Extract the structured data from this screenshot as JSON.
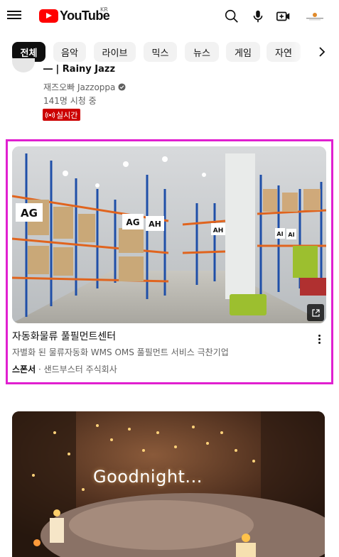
{
  "header": {
    "logo_text": "YouTube",
    "region": "KR"
  },
  "chips": [
    {
      "label": "전체",
      "active": true
    },
    {
      "label": "음악",
      "active": false
    },
    {
      "label": "라이브",
      "active": false
    },
    {
      "label": "믹스",
      "active": false
    },
    {
      "label": "뉴스",
      "active": false
    },
    {
      "label": "게임",
      "active": false
    },
    {
      "label": "자연",
      "active": false
    }
  ],
  "live_video": {
    "title": "― | Rainy Jazz",
    "channel": "재즈오빠 Jazzoppa",
    "views": "141명 시청 중",
    "badge": "실시간"
  },
  "ad": {
    "title": "자동화물류 풀필먼트센터",
    "description": "자별화 된 물류자동화 WMS OMS 풀필먼트 서비스 극찬기업",
    "sponsor_label": "스폰서",
    "separator": " · ",
    "advertiser": "샌드부스터 주식회사",
    "thumbnail_signs": [
      "AG",
      "AG",
      "AH",
      "AH",
      "AI",
      "AI"
    ]
  },
  "next_video": {
    "thumbnail_text": "Goodnight..."
  },
  "colors": {
    "brand_red": "#ff0000",
    "live_red": "#cc0000",
    "highlight_border": "#e020d0",
    "chip_bg": "#f2f2f2"
  }
}
